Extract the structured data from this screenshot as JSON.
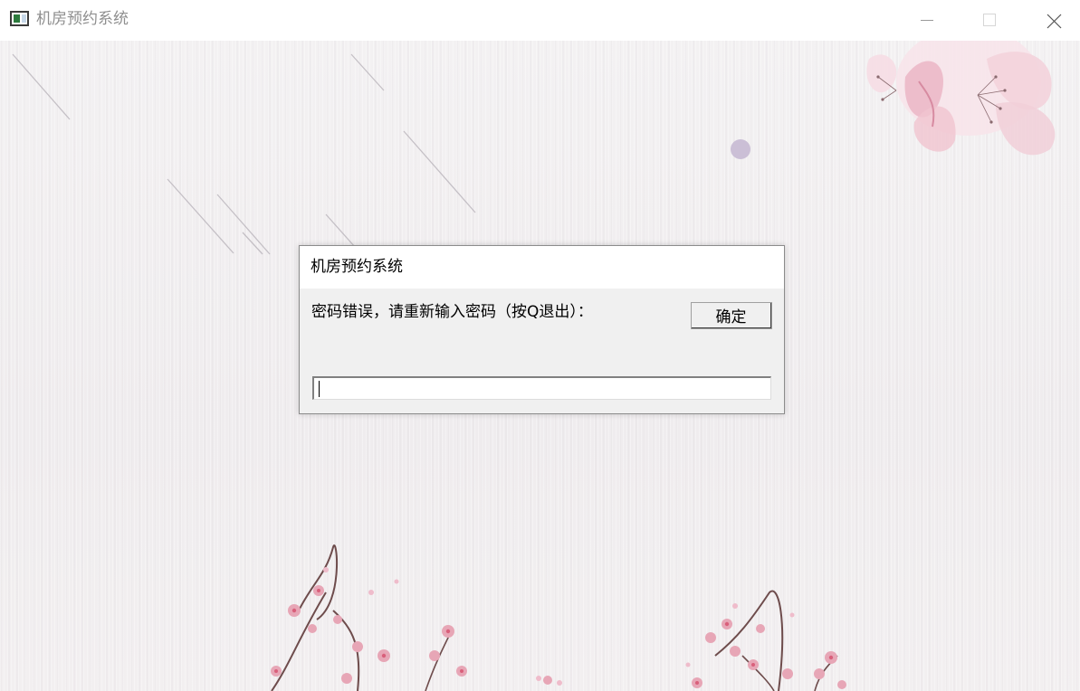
{
  "window": {
    "title": "机房预约系统",
    "controls": {
      "minimize": "minimize",
      "maximize": "maximize",
      "close": "close"
    }
  },
  "dialog": {
    "title": "机房预约系统",
    "message": "密码错误，请重新输入密码（按Q退出）：",
    "ok_label": "确定",
    "input_value": ""
  },
  "colors": {
    "background": "#f4f1f2",
    "blossom": "#e7a6b6",
    "petal_accent": "#d9607b"
  }
}
